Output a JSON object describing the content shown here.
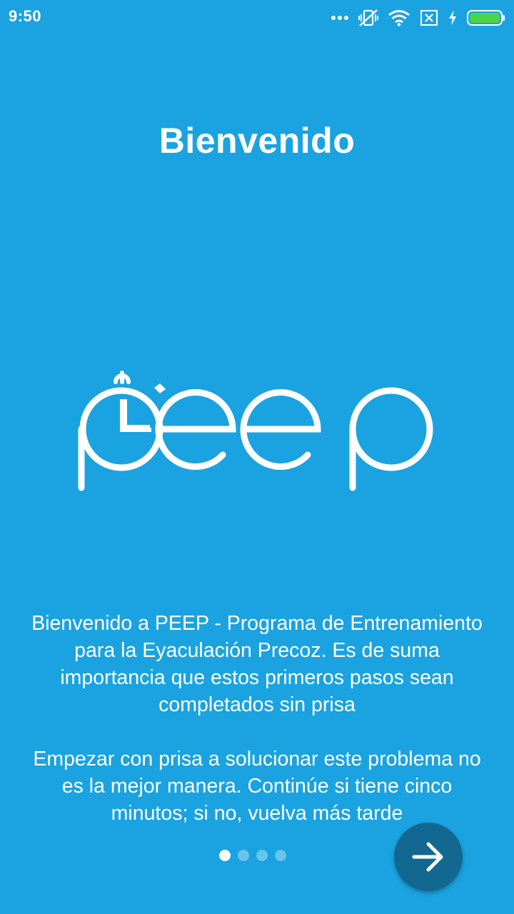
{
  "status_bar": {
    "time": "9:50",
    "icons": [
      "more-dots-icon",
      "vibrate-off-icon",
      "wifi-icon",
      "no-sim-icon",
      "charging-bolt-icon",
      "battery-icon"
    ],
    "battery_color": "#4cd44a"
  },
  "onboarding": {
    "title": "Bienvenido",
    "logo_text": "peep",
    "paragraph_1": "Bienvenido a PEEP - Programa de Entrenamiento para la Eyaculación Precoz. Es de suma importancia que estos primeros pasos sean completados sin prisa",
    "paragraph_2": "Empezar con prisa a solucionar este problema no es la mejor manera. Continúe si tiene cinco minutos; si no, vuelva más tarde",
    "pager": {
      "total": 4,
      "current": 1
    },
    "next_icon": "arrow-right-icon"
  },
  "colors": {
    "background": "#1aa3e0",
    "next_button": "#126891",
    "text": "#ffffff"
  }
}
